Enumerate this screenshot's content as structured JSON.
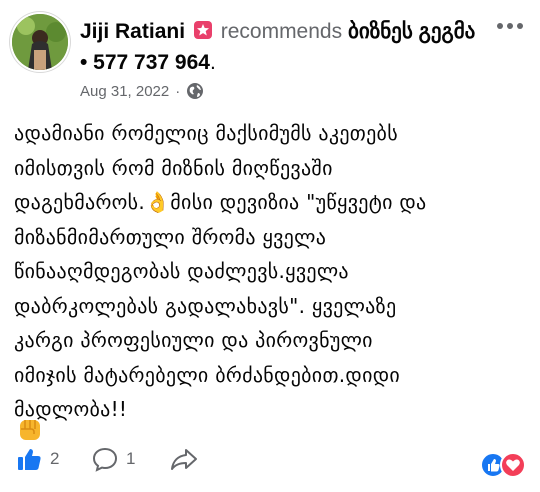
{
  "post": {
    "author": "Jiji Ratiani",
    "recommends_text": "recommends",
    "page_name": "ბიზნეს გეგმა • 577 737 964",
    "period": ".",
    "date": "Aug 31, 2022",
    "separator": "·",
    "body": "ადამიანი რომელიც მაქსიმუმს აკეთებს\nიმისთვის რომ მიზნის მიღწევაში\nდაგეხმაროს.👌მისი დევიზია \"უწყვეტი და\nმიზანმიმართული შრომა ყველა\nწინააღმდეგობას დაძლევს.ყველა\nდაბრკოლებას გადალახავს\". ყველაზე\nკარგი პროფესიული და  პიროვნული\nიმიჯის მატარებელი ბრძანდებით.დიდი\nმადლობა!!"
  },
  "actions": {
    "like_count": "2",
    "comment_count": "1"
  },
  "icons": {
    "avatar": "profile-photo",
    "badge": "recommend-star-badge",
    "audience": "globe-icon",
    "more": "more-options-icon",
    "fist": "raised-fist-emoji",
    "like": "thumbs-up-icon",
    "comment": "comment-bubble-icon",
    "share": "share-arrow-icon"
  },
  "colors": {
    "like_blue": "#1877f2",
    "love_red": "#f33e58",
    "badge_pink": "#e9406b",
    "secondary_text": "#65676b"
  }
}
